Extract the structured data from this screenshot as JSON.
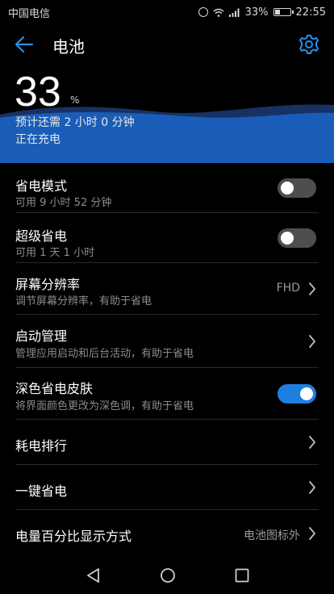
{
  "status_bar": {
    "carrier": "中国电信",
    "battery_percent": "33%",
    "time": "22:55"
  },
  "header": {
    "title": "电池"
  },
  "battery": {
    "level": "33",
    "unit": "%",
    "remaining": "预计还需 2 小时 0 分钟",
    "status": "正在充电"
  },
  "settings": [
    {
      "title": "省电模式",
      "subtitle": "可用 9 小时 52 分钟",
      "control": "toggle",
      "enabled": false
    },
    {
      "title": "超级省电",
      "subtitle": "可用 1 天 1 小时",
      "control": "toggle",
      "enabled": false
    },
    {
      "title": "屏幕分辨率",
      "subtitle": "调节屏幕分辨率，有助于省电",
      "control": "chevron",
      "value": "FHD"
    },
    {
      "title": "启动管理",
      "subtitle": "管理应用启动和后台活动，有助于省电",
      "control": "chevron"
    },
    {
      "title": "深色省电皮肤",
      "subtitle": "将界面颜色更改为深色调，有助于省电",
      "control": "toggle",
      "enabled": true
    },
    {
      "title": "耗电排行",
      "control": "chevron"
    },
    {
      "title": "一键省电",
      "control": "chevron"
    },
    {
      "title": "电量百分比显示方式",
      "control": "chevron",
      "value": "电池图标外"
    }
  ],
  "colors": {
    "accent": "#1f7fe0",
    "wave": "#1a5db8",
    "background": "#000000"
  }
}
